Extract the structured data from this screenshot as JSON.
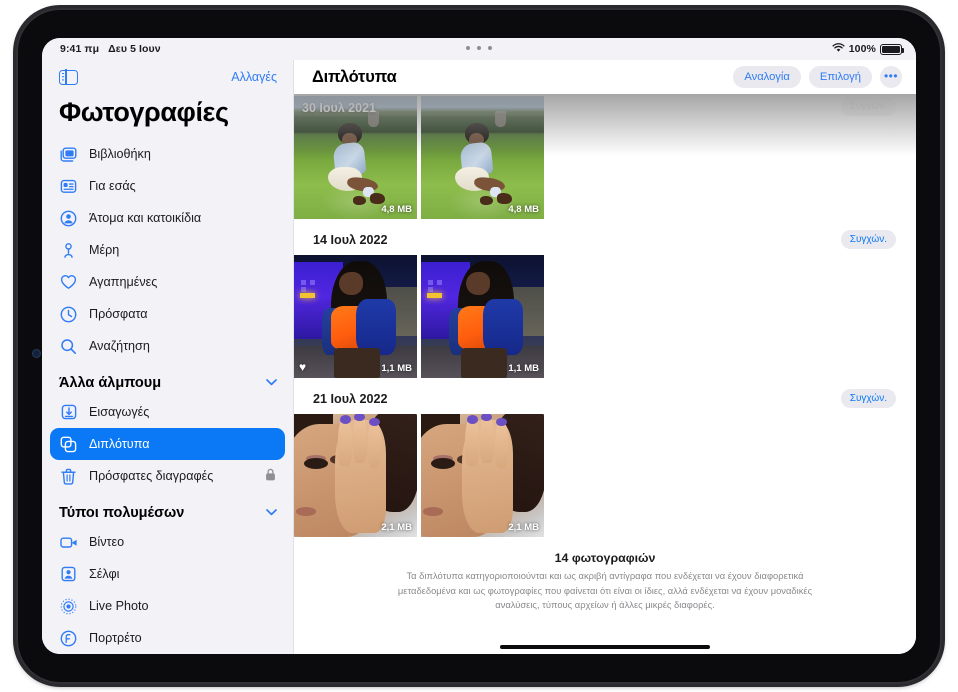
{
  "status_bar": {
    "time": "9:41 πμ",
    "date": "Δευ 5 Ιουν",
    "wifi_icon": "wifi-icon",
    "battery_percent": "100%"
  },
  "sidebar": {
    "toggle_icon": "sidebar-toggle-icon",
    "edit_label": "Αλλαγές",
    "title": "Φωτογραφίες",
    "primary_items": [
      {
        "label": "Βιβλιοθήκη",
        "icon": "photo-stack-icon"
      },
      {
        "label": "Για εσάς",
        "icon": "for-you-card-icon"
      },
      {
        "label": "Άτομα και κατοικίδια",
        "icon": "person-circle-icon"
      },
      {
        "label": "Μέρη",
        "icon": "map-pin-icon"
      },
      {
        "label": "Αγαπημένες",
        "icon": "heart-icon"
      },
      {
        "label": "Πρόσφατα",
        "icon": "clock-icon"
      },
      {
        "label": "Αναζήτηση",
        "icon": "search-icon"
      }
    ],
    "sections": [
      {
        "title": "Άλλα άλμπουμ",
        "chevron_icon": "chevron-down-icon",
        "items": [
          {
            "label": "Εισαγωγές",
            "icon": "import-arrow-icon",
            "selected": false,
            "locked": false
          },
          {
            "label": "Διπλότυπα",
            "icon": "duplicate-squares-icon",
            "selected": true,
            "locked": false
          },
          {
            "label": "Πρόσφατες διαγραφές",
            "icon": "trash-icon",
            "selected": false,
            "locked": true,
            "lock_icon": "lock-icon"
          }
        ]
      },
      {
        "title": "Τύποι πολυμέσων",
        "chevron_icon": "chevron-down-icon",
        "items": [
          {
            "label": "Βίντεο",
            "icon": "video-camera-icon",
            "selected": false,
            "locked": false
          },
          {
            "label": "Σέλφι",
            "icon": "selfie-person-icon",
            "selected": false,
            "locked": false
          },
          {
            "label": "Live Photo",
            "icon": "live-photo-icon",
            "selected": false,
            "locked": false
          },
          {
            "label": "Πορτρέτο",
            "icon": "portrait-f-icon",
            "selected": false,
            "locked": false
          }
        ]
      }
    ]
  },
  "main": {
    "title": "Διπλότυπα",
    "actions": [
      {
        "label": "Αναλογία",
        "name": "aspect-ratio-button"
      },
      {
        "label": "Επιλογή",
        "name": "select-button"
      }
    ],
    "more_button": {
      "label": "•••",
      "name": "more-options-button"
    },
    "groups": [
      {
        "date": "30 Ιουλ 2021",
        "date_on_photo": true,
        "merge_label": "Συγχών.",
        "merge_dimmed": true,
        "art": "garden",
        "photos": [
          {
            "size": "4,8 MB",
            "favorite": false
          },
          {
            "size": "4,8 MB",
            "favorite": false
          }
        ]
      },
      {
        "date": "14 Ιουλ 2022",
        "date_on_photo": false,
        "merge_label": "Συγχών.",
        "merge_dimmed": false,
        "art": "night",
        "photos": [
          {
            "size": "1,1 MB",
            "favorite": true
          },
          {
            "size": "1,1 MB",
            "favorite": false
          }
        ]
      },
      {
        "date": "21 Ιουλ 2022",
        "date_on_photo": false,
        "merge_label": "Συγχών.",
        "merge_dimmed": false,
        "art": "face",
        "photos": [
          {
            "size": "2,1 MB",
            "favorite": false
          },
          {
            "size": "2,1 MB",
            "favorite": false
          }
        ]
      }
    ],
    "footer": {
      "title": "14 φωτογραφιών",
      "description": "Τα διπλότυπα κατηγοριοποιούνται και ως ακριβή αντίγραφα που ενδέχεται να έχουν διαφορετικά μεταδεδομένα και ως φωτογραφίες που φαίνεται ότι είναι οι ίδιες, αλλά ενδέχεται να έχουν μοναδικές αναλύσεις, τύπους αρχείων ή άλλες μικρές διαφορές."
    }
  },
  "colors": {
    "accent_blue": "#0b78f6",
    "icon_blue": "#2f7cf6",
    "sidebar_bg": "#f2f2f7",
    "pill_bg": "#e9e9ef",
    "secondary_text": "#8a8a8e"
  }
}
